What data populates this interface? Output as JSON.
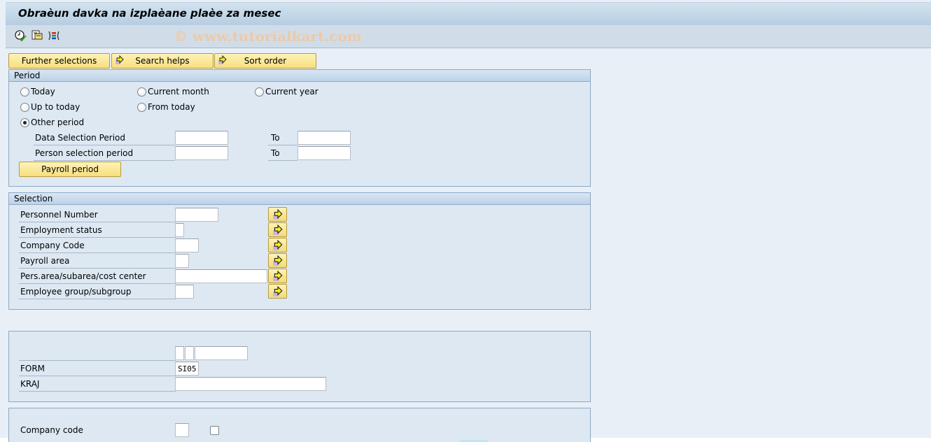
{
  "window": {
    "title": "Obraèun davka na izplaèane plaèe za mesec",
    "watermark": "© www.tutorialkart.com"
  },
  "toolbar": {
    "icons": [
      {
        "name": "execute-clock-icon",
        "tooltip": "Execute"
      },
      {
        "name": "get-variant-icon",
        "tooltip": "Get Variant"
      },
      {
        "name": "selection-options-icon",
        "tooltip": "Selection options"
      }
    ]
  },
  "top_buttons": {
    "further_selections": "Further selections",
    "search_helps": "Search helps",
    "sort_order": "Sort order"
  },
  "period": {
    "header": "Period",
    "radios": {
      "today": "Today",
      "current_month": "Current month",
      "current_year": "Current year",
      "up_to_today": "Up to today",
      "from_today": "From today",
      "other_period": "Other period"
    },
    "selected": "other_period",
    "data_selection_label": "Data Selection Period",
    "data_selection_from": "",
    "data_selection_to_label": "To",
    "data_selection_to": "",
    "person_selection_label": "Person selection period",
    "person_selection_from": "",
    "person_selection_to_label": "To",
    "person_selection_to": "",
    "payroll_period_button": "Payroll period"
  },
  "selection": {
    "header": "Selection",
    "fields": [
      {
        "label": "Personnel Number",
        "value": ""
      },
      {
        "label": "Employment status",
        "value": ""
      },
      {
        "label": "Company Code",
        "value": ""
      },
      {
        "label": "Payroll area",
        "value": ""
      },
      {
        "label": "Pers.area/subarea/cost center",
        "value": ""
      },
      {
        "label": "Employee group/subgroup",
        "value": ""
      }
    ]
  },
  "form_block": {
    "unnamed_field_1": "",
    "unnamed_field_2": "",
    "unnamed_field_3": "",
    "form_label": "FORM",
    "form_value": "SI05",
    "kraj_label": "KRAJ",
    "kraj_value": ""
  },
  "company_block": {
    "company_code_label": "Company code",
    "company_code_value": "",
    "checkbox_checked": false
  }
}
